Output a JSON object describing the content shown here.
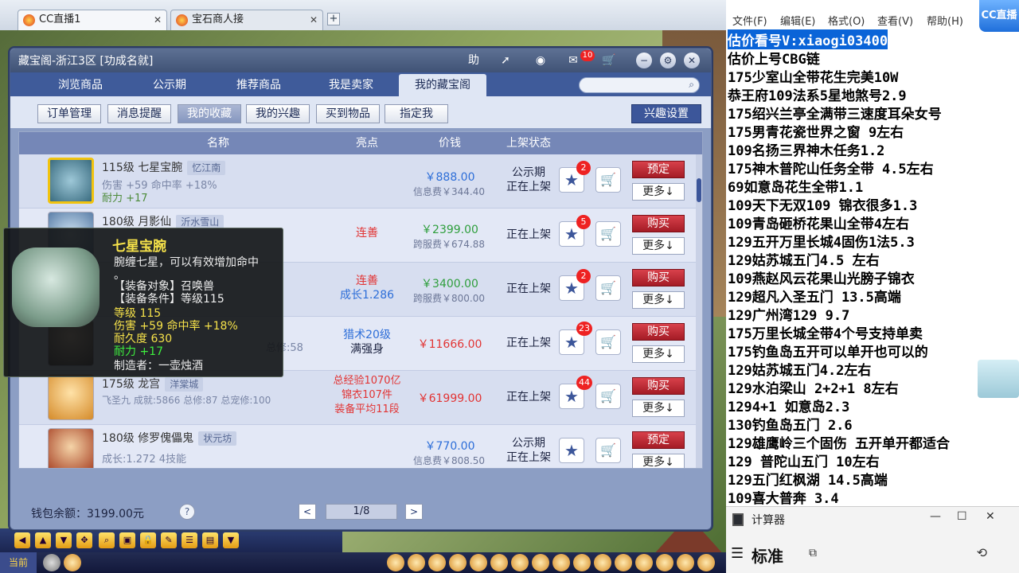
{
  "browser": {
    "tabs": [
      {
        "label": "CC直播1"
      },
      {
        "label": "宝石商人接"
      }
    ],
    "close": "✕",
    "new_tab": "+"
  },
  "game": {
    "bottom_current": "当前",
    "toolbar_glyphs": [
      "◀",
      "▲",
      "▼",
      "✥",
      "⌕",
      "▣",
      "🔒",
      "✎",
      "☰",
      "▤",
      "▼"
    ]
  },
  "window": {
    "title": "藏宝阁-浙江3区 [功成名就]",
    "header_buttons": {
      "help": "助",
      "share": "➚",
      "stop": "◉",
      "cart": "🛒"
    },
    "notif_count": "10",
    "controls": {
      "min": "−",
      "settings": "⚙",
      "close": "✕"
    },
    "nav_tabs": [
      "浏览商品",
      "公示期",
      "推荐商品",
      "我是卖家",
      "我的藏宝阁"
    ],
    "active_nav": "我的藏宝阁",
    "search_icon": "⌕",
    "sub_tabs": [
      "订单管理",
      "消息提醒",
      "我的收藏",
      "我的兴趣",
      "买到物品",
      "指定我"
    ],
    "active_sub": "我的收藏",
    "interest_button": "兴趣设置",
    "columns": [
      "名称",
      "亮点",
      "价钱",
      "上架状态"
    ],
    "rows": [
      {
        "level": "115级",
        "name": "七星宝腕",
        "server": "忆江南",
        "desc1": "伤害 +59 命中率 +18%",
        "desc2": "耐力 +17",
        "highlight1": "",
        "highlight2": "",
        "highlight3": "",
        "price": "￥888.00",
        "fee": "信息费￥344.40",
        "status1": "公示期",
        "status2": "正在上架",
        "favs": "2",
        "action": "预定",
        "more": "更多↓"
      },
      {
        "level": "180级",
        "name": "月影仙",
        "server": "沂水雪山",
        "desc1": "",
        "desc2": "",
        "highlight1": "连善",
        "highlight2": "",
        "highlight3": "",
        "price": "￥2399.00",
        "fee": "跨服费￥674.88",
        "status1": "",
        "status2": "正在上架",
        "favs": "5",
        "action": "购买",
        "more": "更多↓"
      },
      {
        "level": "",
        "name": "",
        "server": "",
        "desc1": "",
        "desc2": "",
        "highlight1": "连善",
        "highlight2": "成长1.286",
        "highlight3": "",
        "price": "￥3400.00",
        "fee": "跨服费￥800.00",
        "status1": "",
        "status2": "正在上架",
        "favs": "2",
        "action": "购买",
        "more": "更多↓"
      },
      {
        "level": "",
        "name": "",
        "server": "",
        "desc1": "总修:58",
        "desc2": "",
        "highlight1": "猎术20级",
        "highlight2": "满强身",
        "highlight3": "",
        "price": "￥11666.00",
        "fee": "",
        "status1": "",
        "status2": "正在上架",
        "favs": "23",
        "action": "购买",
        "more": "更多↓"
      },
      {
        "level": "175级",
        "name": "龙宫",
        "server": "洋棠城",
        "desc1": "飞圣九 成就:5866 总修:87 总宠修:100",
        "desc2": "",
        "highlight1": "总经验1070亿",
        "highlight2": "锦衣107件",
        "highlight3": "装备平均11段",
        "price": "￥61999.00",
        "fee": "",
        "status1": "",
        "status2": "正在上架",
        "favs": "44",
        "action": "购买",
        "more": "更多↓"
      },
      {
        "level": "180级",
        "name": "修罗傀儡鬼",
        "server": "状元坊",
        "desc1": "成长:1.272 4技能",
        "desc2": "",
        "highlight1": "",
        "highlight2": "",
        "highlight3": "",
        "price": "￥770.00",
        "fee": "信息费￥808.50",
        "status1": "公示期",
        "status2": "正在上架",
        "favs": "",
        "action": "预定",
        "more": "更多↓"
      }
    ],
    "wallet": "钱包余额：3199.00元",
    "help_q": "?",
    "page": "1/8",
    "prev": "<",
    "next": ">",
    "star_icon": "★",
    "cart_icon": "🛒"
  },
  "tooltip": {
    "name": "七星宝腕",
    "lines": [
      "腕缠七星，可以有效增加命中",
      "。",
      "【装备对象】召唤兽",
      "【装备条件】等级115",
      "等级 115",
      "伤害 +59 命中率 +18%",
      "耐久度 630",
      "耐力 +17",
      "制造者：一壶烛酒"
    ]
  },
  "notepad": {
    "menu": [
      "文件(F)",
      "编辑(E)",
      "格式(O)",
      "查看(V)",
      "帮助(H)"
    ],
    "logo": "CC直播",
    "lines": [
      "估价看号V:xiaogi03400",
      "估价上号CBG链",
      "175少室山全带花生完美10W",
      "恭王府109法系5星地煞号2.9",
      "175绍兴兰亭全满带三速度耳朵女号",
      "175男青花瓷世界之窗  9左右",
      "109名扬三界神木任务1.2",
      "175神木普陀山任务全带 4.5左右",
      "69如意岛花生全带1.1",
      "109天下无双109  锦衣很多1.3",
      "109青岛砸桥花果山全带4左右",
      "129五开万里长城4固伤1法5.3",
      "129姑苏城五门4.5 左右",
      "109燕赵风云花果山光膀子锦衣",
      "129超凡入圣五门  13.5高端",
      "129广州湾129 9.7",
      "175万里长城全带4个号支持单卖",
      "175钓鱼岛五开可以单开也可以的",
      "129姑苏城五门4.2左右",
      "129水泊梁山 2+2+1 8左右",
      "1294+1 如意岛2.3",
      "130钓鱼岛五门  2.6",
      "129雄鹰岭三个固伤 五开单开都适合",
      "129 普陀山五门  10左右",
      "129五门红枫湖 14.5高端",
      "109喜大普奔  3.4"
    ]
  },
  "calculator": {
    "title": "计算器",
    "min": "—",
    "max": "☐",
    "close": "✕",
    "mode": "标准",
    "menu": "☰",
    "keep_on_top": "⧉",
    "history": "⟲"
  }
}
